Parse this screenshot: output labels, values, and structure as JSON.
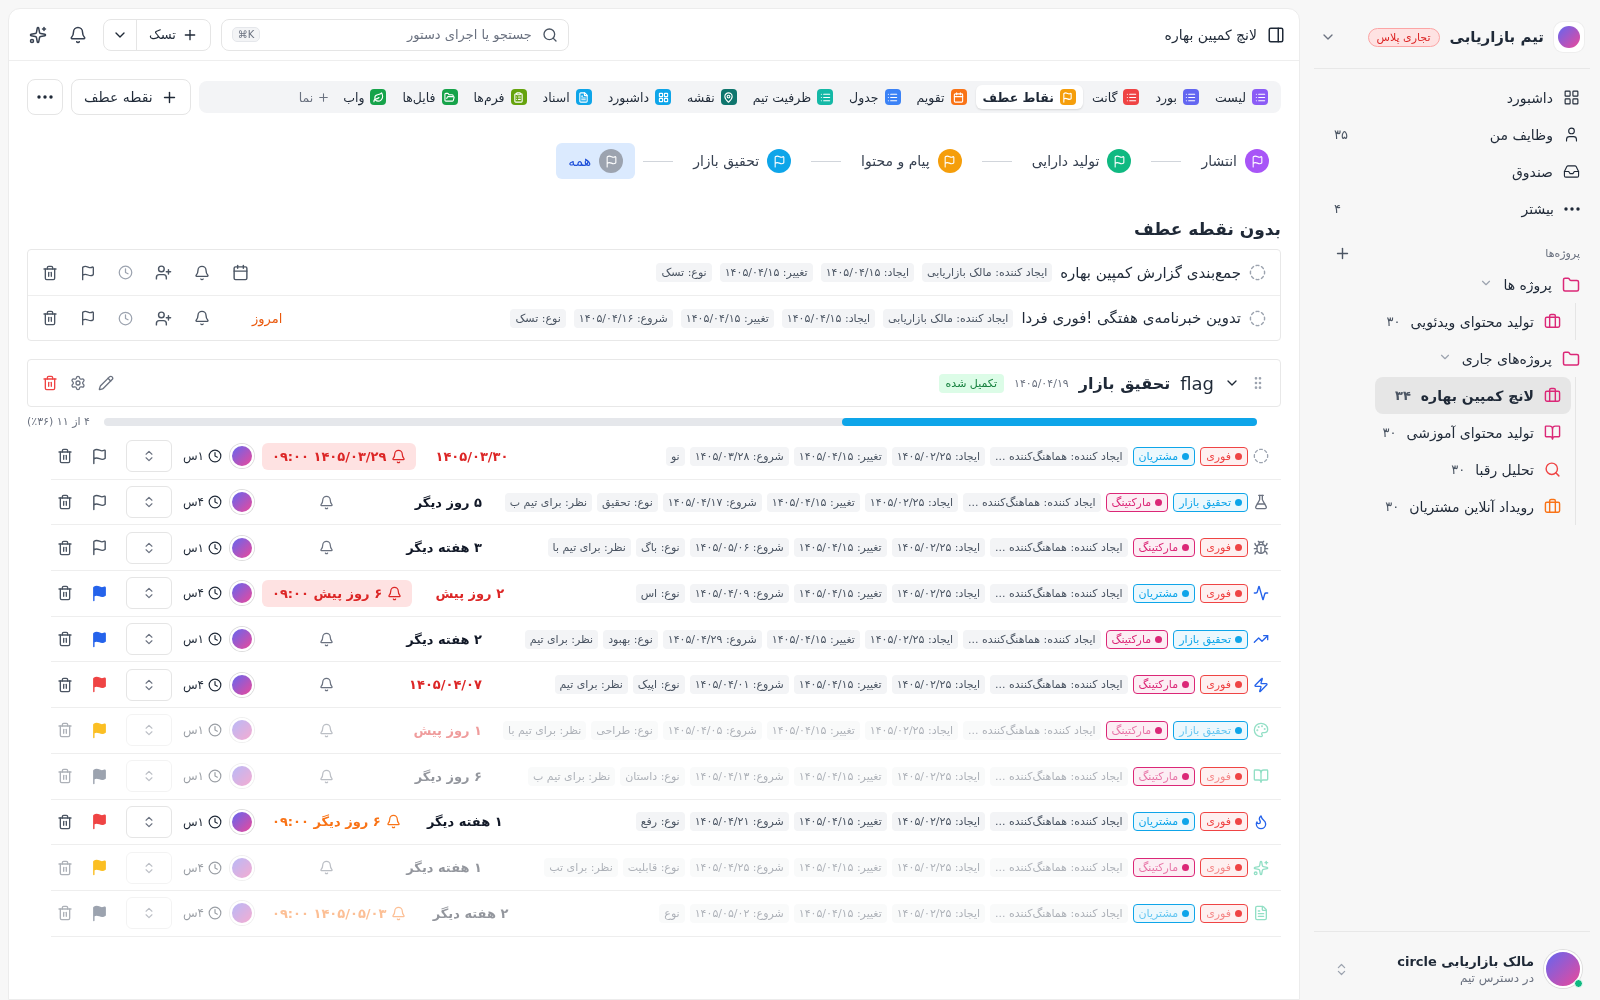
{
  "sidebar": {
    "workspace": "تیم بازاریابی",
    "plan": "تجاری پلاس",
    "nav": [
      {
        "label": "داشبورد"
      },
      {
        "label": "وظایف من",
        "count": "۳۵"
      },
      {
        "label": "صندوق"
      },
      {
        "label": "بیشتر",
        "count": "۴"
      }
    ],
    "projects_heading": "پروژه‌ها",
    "tree": [
      {
        "label": "پروژه ها",
        "expanded": true,
        "children": [
          {
            "color": "#db2777",
            "label": "تولید محتوای ویدئویی",
            "count": "۳۰",
            "selected": false
          }
        ]
      },
      {
        "label": "پروژه‌های جاری",
        "expanded": true,
        "children": [
          {
            "color": "#db2777",
            "label": "لانچ کمپین بهاره",
            "count": "۳۴",
            "selected": true
          },
          {
            "color": "#db2777",
            "label": "تولید محتوای آموزشی",
            "count": "۳۰",
            "selected": false
          },
          {
            "color": "#ef4444",
            "label": "تحلیل رقبا",
            "count": "۳۰",
            "selected": false
          },
          {
            "color": "#f97316",
            "label": "رویداد آنلاین مشتریان",
            "count": "۳۰",
            "selected": false
          }
        ]
      }
    ],
    "user": {
      "name": "مالک بازاریابی circle",
      "status": "در دسترس تیم",
      "online": true
    }
  },
  "topbar": {
    "breadcrumb": "لانچ کمپین بهاره",
    "search": {
      "placeholder": "جستجو یا اجرای دستور",
      "shortcut": "⌘K"
    },
    "new_button": "تسک"
  },
  "views": [
    {
      "color": "#8b5cf6",
      "label": "لیست",
      "selected": false
    },
    {
      "color": "#6366f1",
      "label": "بورد",
      "selected": false
    },
    {
      "color": "#ef4444",
      "label": "گانت",
      "selected": false
    },
    {
      "color": "#f59e0b",
      "label": "نقاط عطف",
      "selected": true
    },
    {
      "color": "#f97316",
      "label": "تقویم",
      "selected": false
    },
    {
      "color": "#3b82f6",
      "label": "جدول",
      "selected": false
    },
    {
      "color": "#14b8a6",
      "label": "ظرفیت تیم",
      "selected": false
    },
    {
      "color": "#0f766e",
      "label": "نقشه",
      "selected": false
    },
    {
      "color": "#0ea5e9",
      "label": "داشبورد",
      "selected": false
    },
    {
      "color": "#0ea5e9",
      "label": "اسناد",
      "selected": false
    },
    {
      "color": "#65a30d",
      "label": "فرم‌ها",
      "selected": false
    },
    {
      "color": "#16a34a",
      "label": "فایل‌ها",
      "selected": false
    },
    {
      "color": "#16a34a",
      "label": "واب",
      "selected": false
    }
  ],
  "add_view": "نما",
  "add_milestone": "نقطه عطف",
  "milestone_filters": [
    {
      "label": "انتشار",
      "color": "#a855f7",
      "selected": false
    },
    {
      "label": "تولید دارایی",
      "color": "#10b981",
      "selected": false
    },
    {
      "label": "پیام و محتوا",
      "color": "#f59e0b",
      "selected": false
    },
    {
      "label": "تحقیق بازار",
      "color": "#0ea5e9",
      "selected": false
    },
    {
      "label": "همه",
      "color": "#9ca3af",
      "selected": true
    }
  ],
  "no_milestone": {
    "title": "بدون نقطه عطف",
    "tasks": [
      {
        "title": "جمع‌بندی گزارش کمپین بهاره",
        "chips": [
          "ایجاد کننده: مالک بازاریابی",
          "ایجاد: ۱۴۰۵/۰۴/۱۵",
          "تغییر: ۱۴۰۵/۰۴/۱۵",
          "نوع: تسک"
        ]
      },
      {
        "title": "تدوین خبرنامه‌ی هفتگی !فوری فردا",
        "chips": [
          "ایجاد کننده: مالک بازاریابی",
          "ایجاد: ۱۴۰۵/۰۴/۱۵",
          "تغییر: ۱۴۰۵/۰۴/۱۵",
          "شروع: ۱۴۰۵/۰۴/۱۶",
          "نوع: تسک"
        ],
        "due": "امروز"
      }
    ]
  },
  "group": {
    "label": "flag",
    "title": "تحقیق بازار",
    "date": "۱۴۰۵/۰۴/۱۹",
    "status": "تکمیل شده",
    "expanded": true,
    "progress": {
      "level": 0.36,
      "text": "۴ از ۱۱ (۳۶٪)"
    },
    "tasks": [
      {
        "tags": [
          {
            "label": "فوری",
            "color": "#ef4444"
          },
          {
            "label": "مشتریان",
            "color": "#0ea5e9"
          }
        ],
        "creator": "ایجاد کننده: هماهنگ‌کننده ...",
        "created": "ایجاد: ۱۴۰۵/۰۲/۲۵",
        "modified": "تغییر: ۱۴۰۵/۰۴/۱۵",
        "start": "شروع: ۱۴۰۵/۰۳/۲۸",
        "type": "نو",
        "due": {
          "text": "۱۴۰۵/۰۳/۳۰",
          "overdue": true
        },
        "reminder": {
          "text": "۱۴۰۵/۰۳/۲۹ ۰۹:۰۰",
          "kind": "alert"
        },
        "estimate": "۱س",
        "dimmed": false
      },
      {
        "tags": [
          {
            "label": "تحقیق بازار",
            "color": "#0ea5e9"
          },
          {
            "label": "مارکتینگ",
            "color": "#db2777"
          }
        ],
        "creator": "ایجاد کننده: هماهنگ‌کننده ...",
        "created": "ایجاد: ۱۴۰۵/۰۲/۲۵",
        "modified": "تغییر: ۱۴۰۵/۰۴/۱۵",
        "start": "شروع: ۱۴۰۵/۰۴/۱۷",
        "type": "نوع: تحقیق",
        "review": "نظر: برای تیم ب",
        "due": {
          "text": "۵ روز دیگر",
          "overdue": false
        },
        "estimate": "۴س",
        "dimmed": false
      },
      {
        "tags": [
          {
            "label": "فوری",
            "color": "#ef4444"
          },
          {
            "label": "مارکتینگ",
            "color": "#db2777"
          }
        ],
        "creator": "ایجاد کننده: هماهنگ‌کننده ...",
        "created": "ایجاد: ۱۴۰۵/۰۲/۲۵",
        "modified": "تغییر: ۱۴۰۵/۰۴/۱۵",
        "start": "شروع: ۱۴۰۵/۰۵/۰۶",
        "type": "نوع: باگ",
        "review": "نظر: برای تیم با",
        "due": {
          "text": "۳ هفته دیگر",
          "overdue": false
        },
        "estimate": "۱س",
        "dimmed": false
      },
      {
        "tags": [
          {
            "label": "فوری",
            "color": "#ef4444"
          },
          {
            "label": "مشتریان",
            "color": "#0ea5e9"
          }
        ],
        "creator": "ایجاد کننده: هماهنگ‌کننده ...",
        "created": "ایجاد: ۱۴۰۵/۰۲/۲۵",
        "modified": "تغییر: ۱۴۰۵/۰۴/۱۵",
        "start": "شروع: ۱۴۰۵/۰۴/۰۹",
        "type": "نوع: اس",
        "due": {
          "text": "۲ روز پیش",
          "overdue": true
        },
        "reminder": {
          "text": "۶ روز پیش ۰۹:۰۰",
          "kind": "alert"
        },
        "estimate": "۴س",
        "flag": {
          "color": "#2563eb"
        },
        "dimmed": false
      },
      {
        "tags": [
          {
            "label": "تحقیق بازار",
            "color": "#0ea5e9"
          },
          {
            "label": "مارکتینگ",
            "color": "#db2777"
          }
        ],
        "creator": "ایجاد کننده: هماهنگ‌کننده ...",
        "created": "ایجاد: ۱۴۰۵/۰۲/۲۵",
        "modified": "تغییر: ۱۴۰۵/۰۴/۱۵",
        "start": "شروع: ۱۴۰۵/۰۴/۲۹",
        "type": "نوع: بهبود",
        "review": "نظر: برای تیم",
        "due": {
          "text": "۲ هفته دیگر",
          "overdue": false
        },
        "estimate": "۱س",
        "flag": {
          "color": "#2563eb"
        },
        "dimmed": false
      },
      {
        "tags": [
          {
            "label": "فوری",
            "color": "#ef4444"
          },
          {
            "label": "مارکتینگ",
            "color": "#db2777"
          }
        ],
        "creator": "ایجاد کننده: هماهنگ‌کننده ...",
        "created": "ایجاد: ۱۴۰۵/۰۲/۲۵",
        "modified": "تغییر: ۱۴۰۵/۰۴/۱۵",
        "start": "شروع: ۱۴۰۵/۰۴/۰۱",
        "type": "نوع: اپیک",
        "review": "نظر: برای تیم",
        "due": {
          "text": "۱۴۰۵/۰۴/۰۷",
          "overdue": true
        },
        "estimate": "۴س",
        "flag": {
          "color": "#ef4444"
        },
        "dimmed": false
      },
      {
        "tags": [
          {
            "label": "تحقیق بازار",
            "color": "#0ea5e9"
          },
          {
            "label": "مارکتینگ",
            "color": "#db2777"
          }
        ],
        "creator": "ایجاد کننده: هماهنگ‌کننده ...",
        "created": "ایجاد: ۱۴۰۵/۰۲/۲۵",
        "modified": "تغییر: ۱۴۰۵/۰۴/۱۵",
        "start": "شروع: ۱۴۰۵/۰۴/۰۵",
        "type": "نوع: طراحی",
        "review": "نظر: برای تیم با",
        "due": {
          "text": "۱ روز پیش",
          "overdue": true
        },
        "estimate": "۱س",
        "flag": {
          "color": "#fbbf24"
        },
        "dimmed": true
      },
      {
        "tags": [
          {
            "label": "فوری",
            "color": "#ef4444"
          },
          {
            "label": "مارکتینگ",
            "color": "#db2777"
          }
        ],
        "creator": "ایجاد کننده: هماهنگ‌کننده ...",
        "created": "ایجاد: ۱۴۰۵/۰۲/۲۵",
        "modified": "تغییر: ۱۴۰۵/۰۴/۱۵",
        "start": "شروع: ۱۴۰۵/۰۴/۱۳",
        "type": "نوع: داستان",
        "review": "نظر: برای تیم ب",
        "due": {
          "text": "۶ روز دیگر",
          "overdue": false
        },
        "estimate": "۱س",
        "flag": {
          "color": "#9ca3af"
        },
        "dimmed": true
      },
      {
        "tags": [
          {
            "label": "فوری",
            "color": "#ef4444"
          },
          {
            "label": "مشتریان",
            "color": "#0ea5e9"
          }
        ],
        "creator": "ایجاد کننده: هماهنگ‌کننده ...",
        "created": "ایجاد: ۱۴۰۵/۰۲/۲۵",
        "modified": "تغییر: ۱۴۰۵/۰۴/۱۵",
        "start": "شروع: ۱۴۰۵/۰۴/۲۱",
        "type": "نوع: رفع",
        "due": {
          "text": "۱ هفته دیگر",
          "overdue": false
        },
        "reminder": {
          "text": "۶ روز دیگر ۰۹:۰۰",
          "kind": "warn"
        },
        "estimate": "۱س",
        "flag": {
          "color": "#ef4444"
        },
        "dimmed": false
      },
      {
        "tags": [
          {
            "label": "فوری",
            "color": "#ef4444"
          },
          {
            "label": "مارکتینگ",
            "color": "#db2777"
          }
        ],
        "creator": "ایجاد کننده: هماهنگ‌کننده ...",
        "created": "ایجاد: ۱۴۰۵/۰۲/۲۵",
        "modified": "تغییر: ۱۴۰۵/۰۴/۱۵",
        "start": "شروع: ۱۴۰۵/۰۴/۲۵",
        "type": "نوع: قابلیت",
        "review": "نظر: برای تب",
        "due": {
          "text": "۱ هفته دیگر",
          "overdue": false
        },
        "estimate": "۴س",
        "flag": {
          "color": "#fbbf24"
        },
        "dimmed": true
      },
      {
        "tags": [
          {
            "label": "فوری",
            "color": "#ef4444"
          },
          {
            "label": "مشتریان",
            "color": "#0ea5e9"
          }
        ],
        "creator": "ایجاد کننده: هماهنگ‌کننده ...",
        "created": "ایجاد: ۱۴۰۵/۰۲/۲۵",
        "modified": "تغییر: ۱۴۰۵/۰۴/۱۵",
        "start": "شروع: ۱۴۰۵/۰۵/۰۲",
        "type": "نوع",
        "due": {
          "text": "۲ هفته دیگر",
          "overdue": false
        },
        "reminder": {
          "text": "۱۴۰۵/۰۵/۰۳ ۰۹:۰۰",
          "kind": "warn"
        },
        "estimate": "۴س",
        "flag": {
          "color": "#9ca3af"
        },
        "dimmed": true
      }
    ]
  }
}
